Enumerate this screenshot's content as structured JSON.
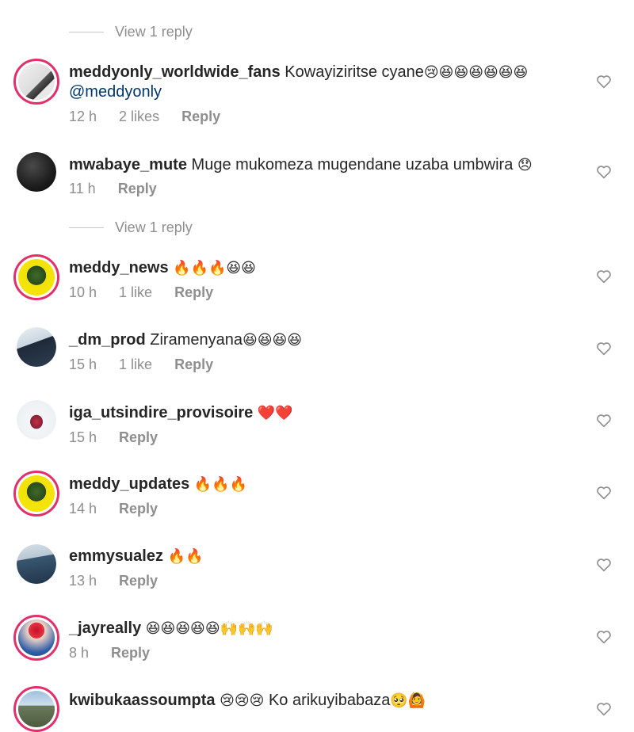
{
  "view_replies": [
    {
      "label": "View 1 reply"
    },
    {
      "label": "View 1 reply"
    }
  ],
  "comments": [
    {
      "username": "meddyonly_worldwide_fans",
      "text": "Kowayiziritse cyane",
      "emoji": "😢😆😆😆😆😆😆",
      "mention": "@meddyonly",
      "time": "12 h",
      "likes": "2 likes",
      "reply": "Reply"
    },
    {
      "username": "mwabaye_mute",
      "text": "Muge mukomeza mugendane uzaba umbwira",
      "emoji": "😞",
      "time": "11 h",
      "likes": "",
      "reply": "Reply"
    },
    {
      "username": "meddy_news",
      "text": "",
      "emoji": "🔥🔥🔥😆😆",
      "time": "10 h",
      "likes": "1 like",
      "reply": "Reply"
    },
    {
      "username": "_dm_prod",
      "text": "Ziramenyana",
      "emoji": "😆😆😆😆",
      "time": "15 h",
      "likes": "1 like",
      "reply": "Reply"
    },
    {
      "username": "iga_utsindire_provisoire",
      "text": "",
      "emoji": "❤️❤️",
      "time": "15 h",
      "likes": "",
      "reply": "Reply"
    },
    {
      "username": "meddy_updates",
      "text": "",
      "emoji": "🔥🔥🔥",
      "time": "14 h",
      "likes": "",
      "reply": "Reply"
    },
    {
      "username": "emmysualez",
      "text": "",
      "emoji": "🔥🔥",
      "time": "13 h",
      "likes": "",
      "reply": "Reply"
    },
    {
      "username": "_jayreally",
      "text": "",
      "emoji": "😆😆😆😆😆🙌🙌🙌",
      "time": "8 h",
      "likes": "",
      "reply": "Reply"
    },
    {
      "username": "kwibukaassoumpta",
      "text": "Ko arikuyibabaza",
      "emoji_before": "😢😢😢",
      "emoji": "🥺🙆",
      "time": "",
      "likes": "",
      "reply": ""
    }
  ],
  "colors": {
    "story_ring": "#e1306c",
    "meta_gray": "#8e8e8e",
    "mention": "#00376b"
  }
}
